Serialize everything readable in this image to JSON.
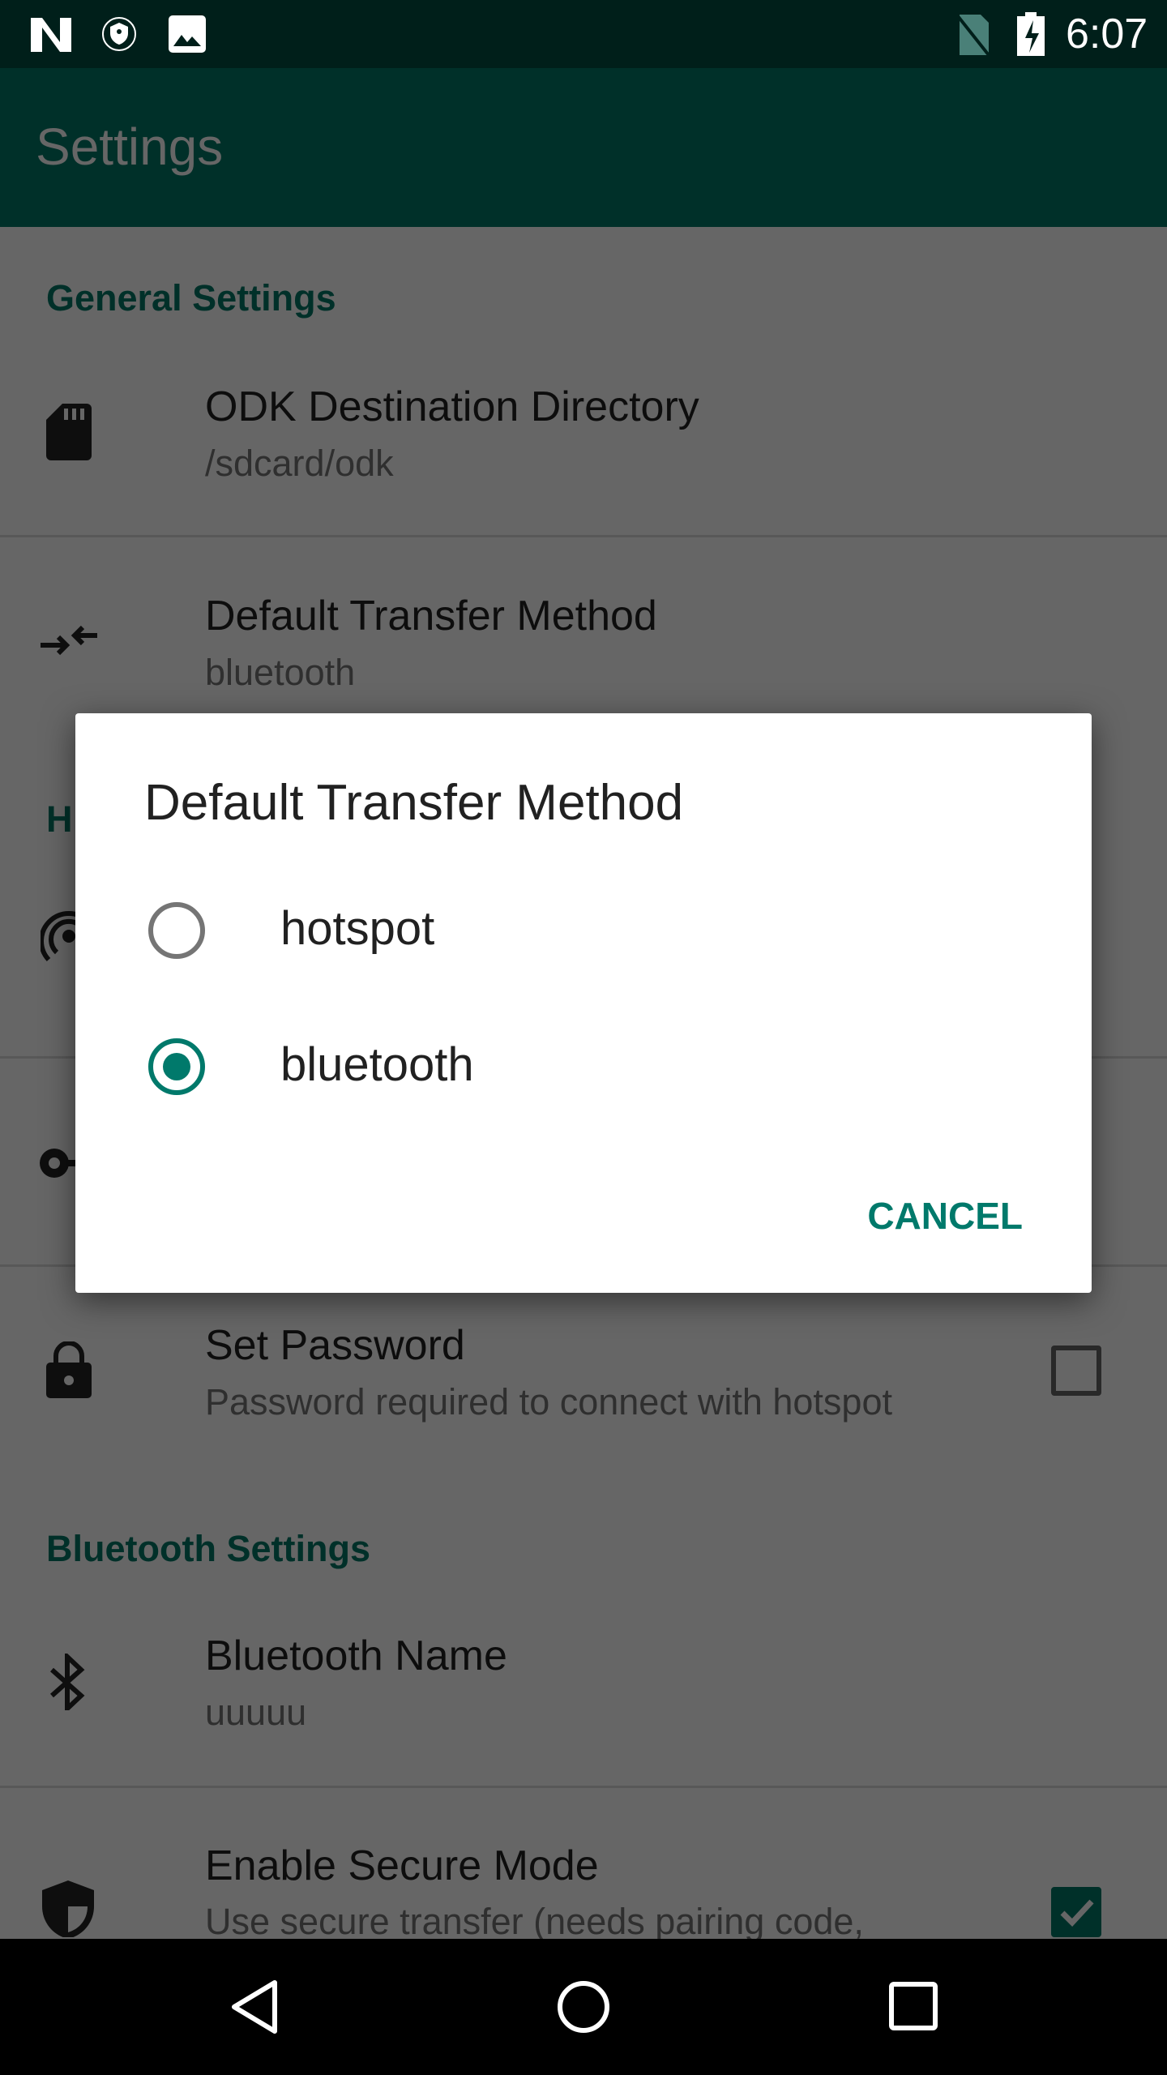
{
  "status_bar": {
    "time": "6:07",
    "icons": [
      "n-logo-icon",
      "vpn-shield-icon",
      "image-icon",
      "no-sim-icon",
      "battery-charging-icon"
    ]
  },
  "app_bar": {
    "title": "Settings"
  },
  "colors": {
    "primary": "#00796b",
    "primary_dark": "#004d40"
  },
  "settings": {
    "general_header": "General Settings",
    "destination": {
      "title": "ODK Destination Directory",
      "value": "/sdcard/odk",
      "icon": "sd-card-icon"
    },
    "transfer": {
      "title": "Default Transfer Method",
      "value": "bluetooth",
      "icon": "transfer-arrows-icon"
    },
    "hotspot_header_partial": "H",
    "set_password": {
      "title": "Set Password",
      "summary": "Password required to connect with hotspot",
      "checked": false,
      "icon": "lock-icon"
    },
    "bluetooth_header": "Bluetooth Settings",
    "bluetooth_name": {
      "title": "Bluetooth Name",
      "value": "uuuuu",
      "icon": "bluetooth-icon"
    },
    "secure_mode": {
      "title": "Enable Secure Mode",
      "summary": "Use secure transfer (needs pairing code,",
      "checked": true,
      "icon": "shield-icon"
    }
  },
  "dialog": {
    "title": "Default Transfer Method",
    "options": [
      {
        "label": "hotspot",
        "selected": false
      },
      {
        "label": "bluetooth",
        "selected": true
      }
    ],
    "cancel": "CANCEL"
  },
  "nav_bar": {
    "buttons": [
      "back-icon",
      "home-icon",
      "recents-icon"
    ]
  }
}
